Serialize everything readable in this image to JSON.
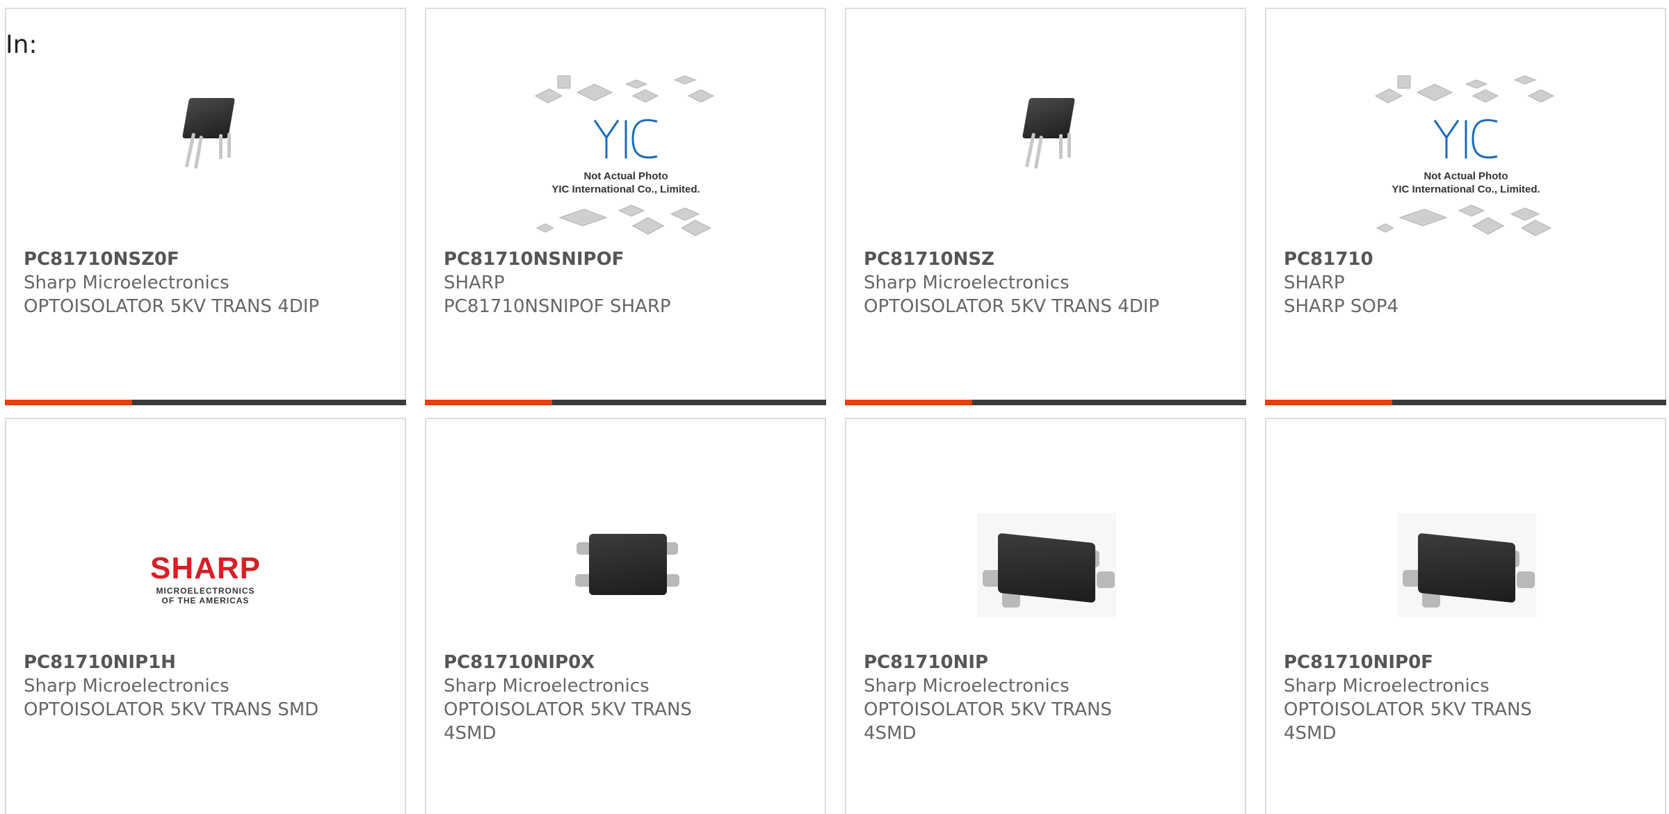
{
  "page": {
    "in_label": "In:"
  },
  "cards": [
    {
      "part": "PC81710NSZ0F",
      "maker": "Sharp Microelectronics",
      "desc": "OPTOISOLATOR 5KV TRANS 4DIP",
      "image": "dip-4-photo"
    },
    {
      "part": "PC81710NSNIPOF",
      "maker": "SHARP",
      "desc": "PC81710NSNIPOF SHARP",
      "image": "placeholder-photo",
      "placeholder": {
        "logo": "YIC",
        "line1": "Not Actual Photo",
        "line2": "YIC International Co., Limited."
      }
    },
    {
      "part": "PC81710NSZ",
      "maker": "Sharp Microelectronics",
      "desc": "OPTOISOLATOR 5KV TRANS 4DIP",
      "image": "dip-4-photo"
    },
    {
      "part": "PC81710",
      "maker": "SHARP",
      "desc": "SHARP SOP4",
      "image": "placeholder-photo",
      "placeholder": {
        "logo": "YIC",
        "line1": "Not Actual Photo",
        "line2": "YIC International Co., Limited."
      }
    },
    {
      "part": "PC81710NIP1H",
      "maker": "Sharp Microelectronics",
      "desc": "OPTOISOLATOR 5KV TRANS SMD",
      "image": "sharp-logo",
      "logo": {
        "word": "SHARP",
        "sub1": "MICROELECTRONICS",
        "sub2": "OF THE AMERICAS"
      }
    },
    {
      "part": "PC81710NIP0X",
      "maker": "Sharp Microelectronics",
      "desc": "OPTOISOLATOR 5KV TRANS 4SMD",
      "image": "smd-4-photo"
    },
    {
      "part": "PC81710NIP",
      "maker": "Sharp Microelectronics",
      "desc": "OPTOISOLATOR 5KV TRANS 4SMD",
      "image": "smd-4-photo"
    },
    {
      "part": "PC81710NIP0F",
      "maker": "Sharp Microelectronics",
      "desc": "OPTOISOLATOR 5KV TRANS 4SMD",
      "image": "smd-4-photo"
    }
  ],
  "colors": {
    "accent": "#e8400c",
    "bar": "#3a3a3a",
    "sharp_red": "#d61f26",
    "yic_blue": "#1c6bb3"
  }
}
